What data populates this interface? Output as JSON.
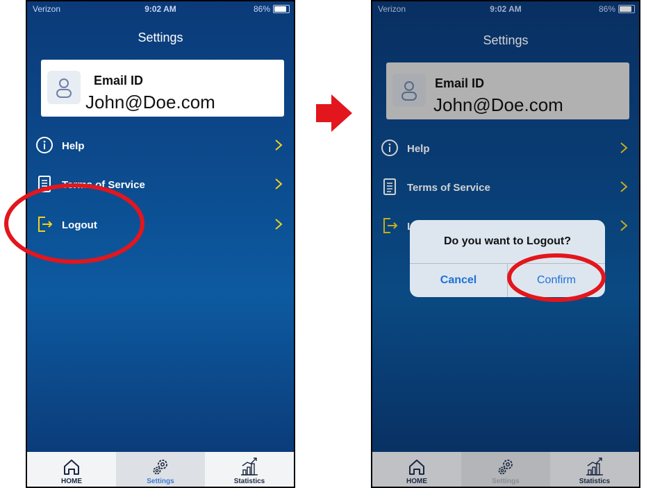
{
  "status": {
    "carrier": "Verizon",
    "time": "9:02 AM",
    "battery": "86%",
    "battery_level": 0.86
  },
  "settings": {
    "title": "Settings",
    "card": {
      "label": "Email ID",
      "value": "John@Doe.com"
    },
    "items": [
      {
        "label": "Help",
        "icon": "info-icon"
      },
      {
        "label": "Terms of Service",
        "icon": "document-icon"
      },
      {
        "label": "Logout",
        "icon": "logout-icon"
      }
    ]
  },
  "tabs": [
    {
      "label": "HOME",
      "icon": "home-icon"
    },
    {
      "label": "Settings",
      "icon": "gears-icon",
      "active": true
    },
    {
      "label": "Statistics",
      "icon": "chart-icon"
    }
  ],
  "dialog": {
    "question": "Do you want to Logout?",
    "cancel": "Cancel",
    "confirm": "Confirm"
  },
  "colors": {
    "accent": "#3a7bd5",
    "annotation": "#e3161d",
    "icon_yellow": "#f2d31b",
    "dialog_button": "#1d6fd8"
  }
}
